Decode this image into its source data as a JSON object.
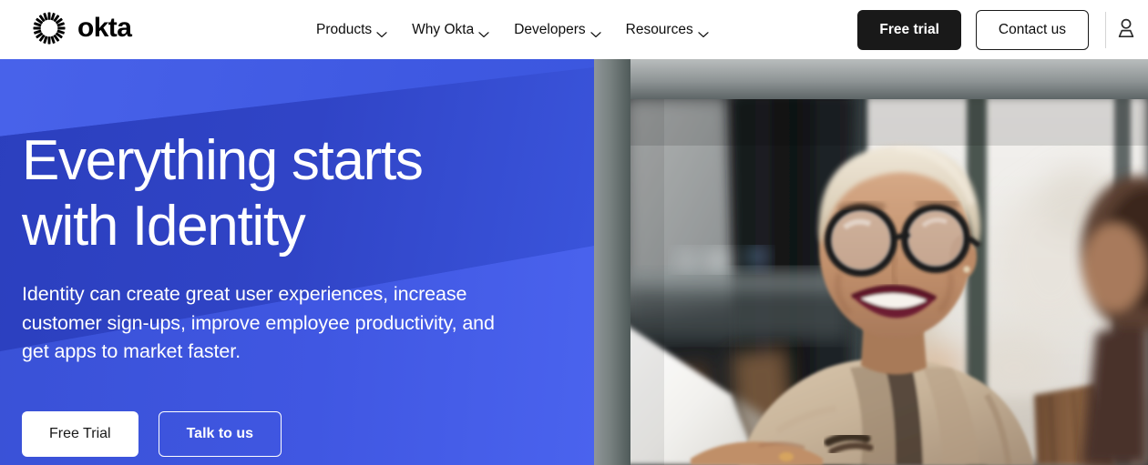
{
  "header": {
    "logo": {
      "icon": "okta-starburst-icon",
      "wordmark": "okta"
    },
    "nav": [
      {
        "label": "Products",
        "icon": "chevron-down-icon"
      },
      {
        "label": "Why Okta",
        "icon": "chevron-down-icon"
      },
      {
        "label": "Developers",
        "icon": "chevron-down-icon"
      },
      {
        "label": "Resources",
        "icon": "chevron-down-icon"
      }
    ],
    "free_trial_label": "Free trial",
    "contact_label": "Contact us",
    "account_icon": "user-account-icon"
  },
  "hero": {
    "title_line_1": "Everything starts",
    "title_line_2": "with Identity",
    "subtitle": "Identity can create great user experiences, increase customer sign-ups, improve employee productivity, and get apps to market faster.",
    "cta_primary": "Free Trial",
    "cta_secondary": "Talk to us",
    "image_alt": "Smiling woman with short blonde hair and round glasses wearing a tan blazer, seated at a white table in a bright modern office with a colleague"
  },
  "colors": {
    "brand_black": "#191919",
    "hero_blue": "#3853d4",
    "hero_blue_light": "#4a64ec",
    "hero_blue_dark": "#2b3fbe",
    "white": "#ffffff"
  }
}
